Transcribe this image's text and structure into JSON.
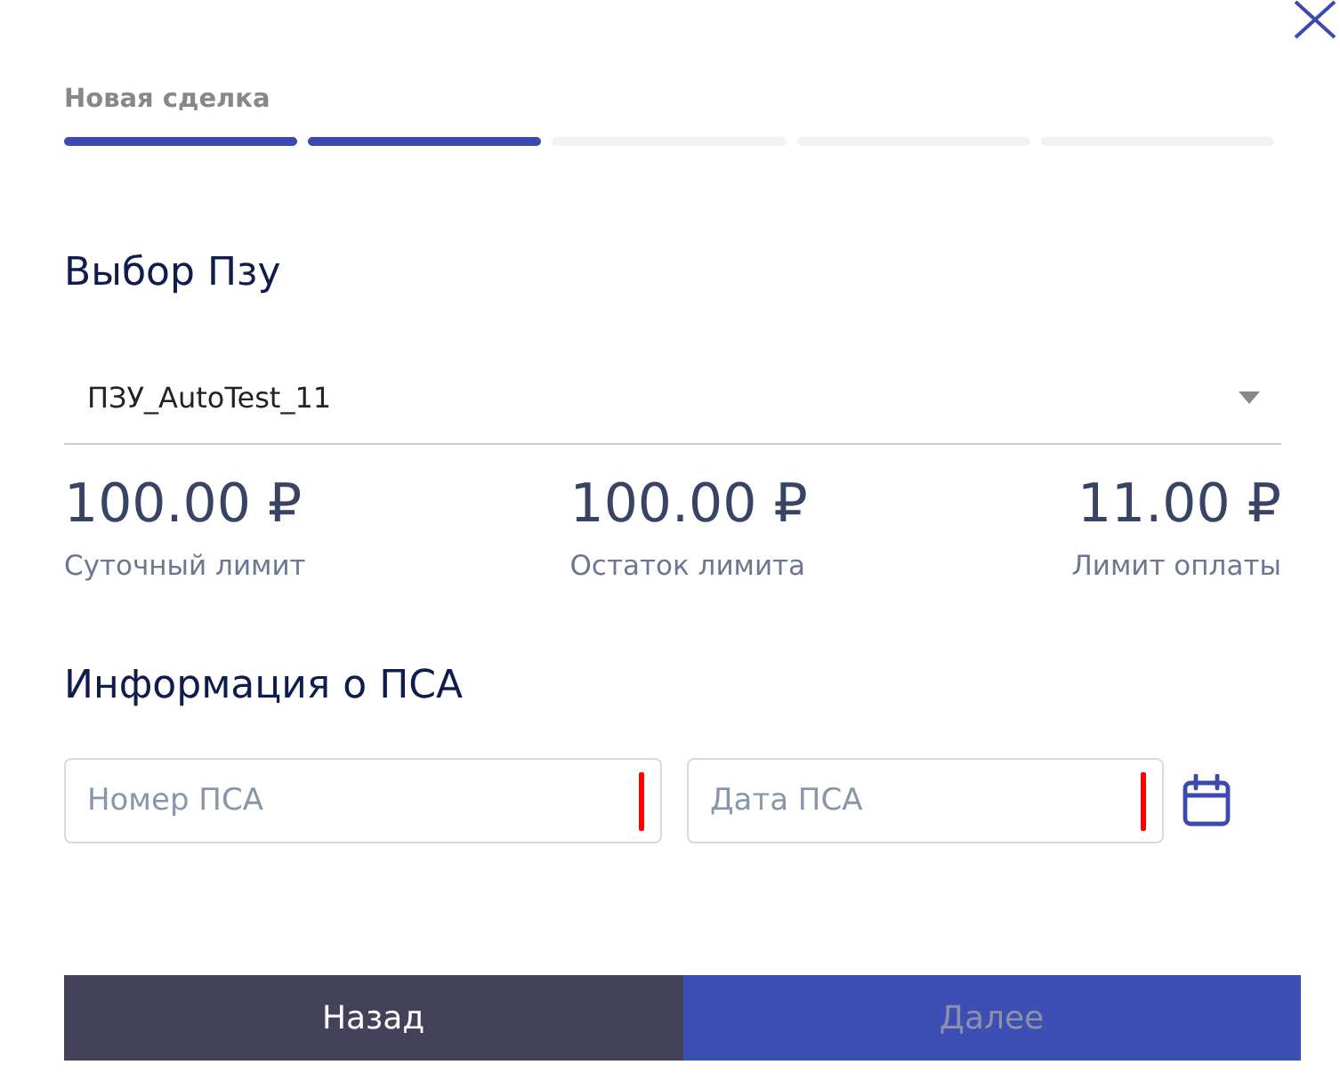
{
  "wizard": {
    "title": "Новая сделка",
    "steps": [
      {
        "completed": true
      },
      {
        "completed": true
      },
      {
        "completed": false
      },
      {
        "completed": false
      },
      {
        "completed": false
      }
    ]
  },
  "pzu_section": {
    "heading": "Выбор Пзу",
    "select": {
      "value": "ПЗУ_AutoTest_11"
    },
    "limits": [
      {
        "amount": "100.00 ₽",
        "label": "Суточный лимит"
      },
      {
        "amount": "100.00 ₽",
        "label": "Остаток лимита"
      },
      {
        "amount": "11.00 ₽",
        "label": "Лимит оплаты"
      }
    ]
  },
  "psa_section": {
    "heading": "Информация о ПСА",
    "fields": [
      {
        "kind": "text",
        "placeholder": "Номер ПСА",
        "required": true
      },
      {
        "kind": "date",
        "placeholder": "Дата ПСА",
        "required": true
      }
    ]
  },
  "buttons": [
    {
      "label": "Назад",
      "kind": "secondary",
      "disabled": false
    },
    {
      "label": "Далее",
      "kind": "primary",
      "disabled": true
    }
  ]
}
